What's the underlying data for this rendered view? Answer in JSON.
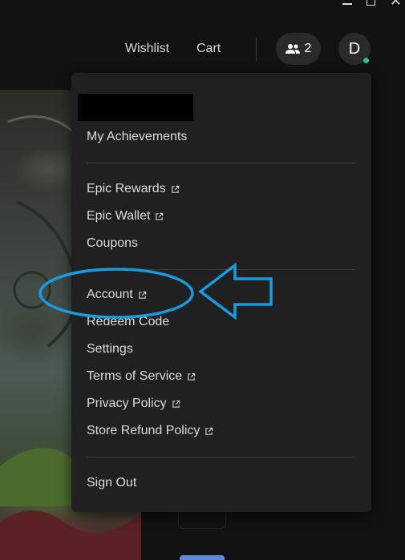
{
  "header": {
    "wishlist_label": "Wishlist",
    "cart_label": "Cart",
    "friends_count": "2",
    "avatar_initial": "D"
  },
  "menu": {
    "top_items": [
      {
        "label": "My Achievements",
        "external": false
      }
    ],
    "group1": [
      {
        "label": "Epic Rewards",
        "external": true
      },
      {
        "label": "Epic Wallet",
        "external": true
      },
      {
        "label": "Coupons",
        "external": false
      }
    ],
    "group2": [
      {
        "label": "Account",
        "external": true
      },
      {
        "label": "Redeem Code",
        "external": false
      },
      {
        "label": "Settings",
        "external": false
      },
      {
        "label": "Terms of Service",
        "external": true
      },
      {
        "label": "Privacy Policy",
        "external": true
      },
      {
        "label": "Store Refund Policy",
        "external": true
      }
    ],
    "sign_out_label": "Sign Out"
  },
  "annotation": {
    "color": "#1a9be0"
  },
  "colors": {
    "menu_bg": "#202020",
    "online_status": "#2ec27e"
  }
}
